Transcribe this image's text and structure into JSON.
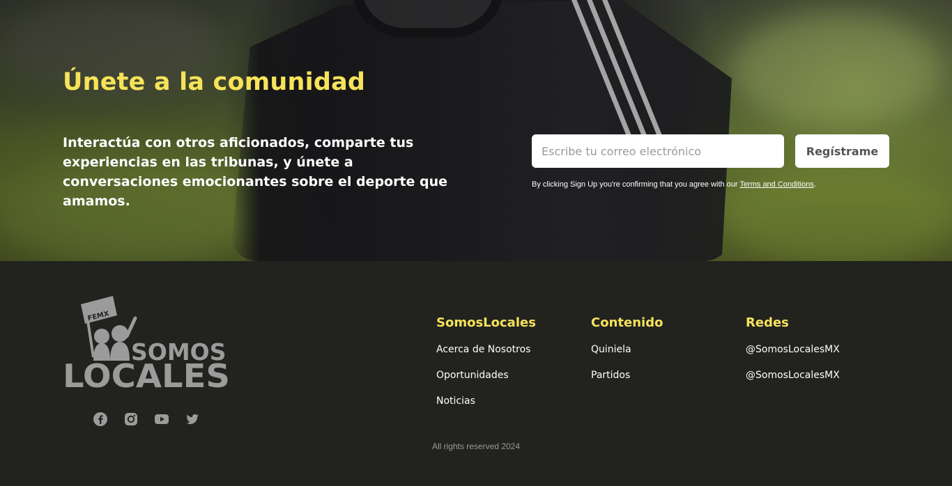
{
  "hero": {
    "title": "Únete a la comunidad",
    "description": "Interactúa con otros aficionados, comparte tus experiencias en las tribunas, y únete a conversaciones emocionantes sobre el deporte que amamos.",
    "email_placeholder": "Escribe tu correo electrónico",
    "register_label": "Regístrame",
    "terms_prefix": "By clicking Sign Up you're confirming that you agree with our ",
    "terms_link": "Terms and Conditions",
    "terms_suffix": "."
  },
  "footer": {
    "logo": {
      "flag_text": "FEMX",
      "line1": "SOMOS",
      "line2": "LOCALES"
    },
    "social_icons": [
      "facebook-icon",
      "instagram-icon",
      "youtube-icon",
      "twitter-icon"
    ],
    "columns": [
      {
        "title": "SomosLocales",
        "links": [
          "Acerca de Nosotros",
          "Oportunidades",
          "Noticias"
        ]
      },
      {
        "title": "Contenido",
        "links": [
          "Quiniela",
          "Partidos"
        ]
      },
      {
        "title": "Redes",
        "links": [
          "@SomosLocalesMX",
          "@SomosLocalesMX"
        ]
      }
    ],
    "copyright": "All rights reserved 2024"
  },
  "colors": {
    "accent": "#f6e35a",
    "footer_bg": "#22221f",
    "logo_gray": "#9b9b9b"
  }
}
